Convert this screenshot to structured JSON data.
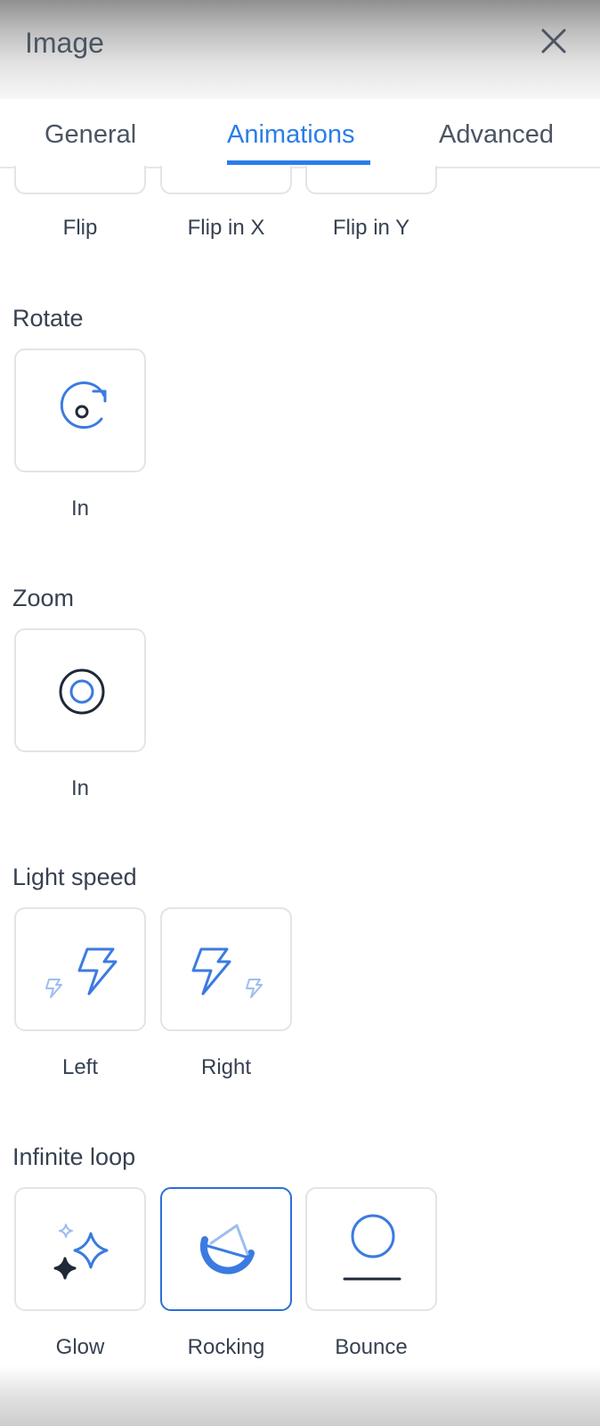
{
  "header": {
    "title": "Image"
  },
  "tabs": [
    {
      "label": "General"
    },
    {
      "label": "Animations"
    },
    {
      "label": "Advanced"
    }
  ],
  "flip": {
    "items": [
      {
        "label": "Flip"
      },
      {
        "label": "Flip in X"
      },
      {
        "label": "Flip in Y"
      }
    ]
  },
  "rotate": {
    "title": "Rotate",
    "items": [
      {
        "label": "In",
        "icon": "rotate-in-icon"
      }
    ]
  },
  "zoom": {
    "title": "Zoom",
    "items": [
      {
        "label": "In",
        "icon": "zoom-in-icon"
      }
    ]
  },
  "light_speed": {
    "title": "Light speed",
    "items": [
      {
        "label": "Left",
        "icon": "lightning-left-icon"
      },
      {
        "label": "Right",
        "icon": "lightning-right-icon"
      }
    ]
  },
  "infinite_loop": {
    "title": "Infinite loop",
    "selected": "Rocking",
    "items": [
      {
        "label": "Glow",
        "icon": "sparkle-icon"
      },
      {
        "label": "Rocking",
        "icon": "rocking-icon"
      },
      {
        "label": "Bounce",
        "icon": "bounce-icon"
      }
    ]
  },
  "colors": {
    "accent": "#2b7de9",
    "icon_blue": "#3b7be0",
    "icon_light_blue": "#9dbdf0",
    "icon_dark": "#1f2937",
    "border": "#e2e4e8"
  }
}
